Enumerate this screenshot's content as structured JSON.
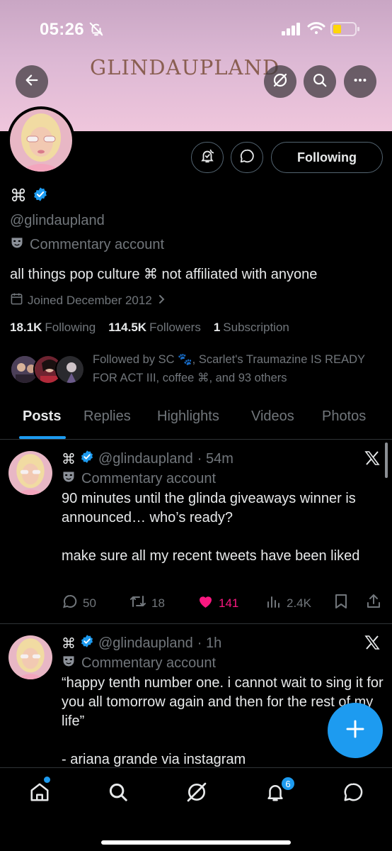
{
  "status_bar": {
    "time": "05:26"
  },
  "banner": {
    "title": "GLINDAUPLAND"
  },
  "profile": {
    "display_name": "⌘",
    "handle": "@glindaupland",
    "label": "Commentary account",
    "bio": "all things pop culture ⌘ not affiliated with anyone",
    "joined": "Joined December 2012",
    "following_button": "Following",
    "stats": {
      "following_count": "18.1K",
      "following_label": "Following",
      "followers_count": "114.5K",
      "followers_label": "Followers",
      "subscriptions_count": "1",
      "subscriptions_label": "Subscription"
    },
    "followed_by": "Followed by SC 🐾, Scarlet's Traumazine IS READY FOR ACT III, coffee ⌘, and 93 others"
  },
  "tabs": [
    "Posts",
    "Replies",
    "Highlights",
    "Videos",
    "Photos"
  ],
  "active_tab": "Posts",
  "posts": [
    {
      "display_name": "⌘",
      "handle": "@glindaupland",
      "time": "· 54m",
      "label": "Commentary account",
      "text": "90 minutes until the glinda giveaways winner is announced… who’s ready?\n\nmake sure all my recent tweets have been liked",
      "replies": "50",
      "reposts": "18",
      "likes": "141",
      "views": "2.4K"
    },
    {
      "display_name": "⌘",
      "handle": "@glindaupland",
      "time": "· 1h",
      "label": "Commentary account",
      "text": "“happy tenth number one. i cannot wait to sing it for you all tomorrow again and then for the rest of my life”\n\n- ariana grande via instagram"
    }
  ],
  "nav": {
    "notifications_badge": "6"
  },
  "colors": {
    "accent": "#1d9bf0",
    "like": "#f91880",
    "background": "#000000",
    "muted": "#71767b"
  },
  "icons": [
    "back-arrow-icon",
    "grok-icon",
    "search-icon",
    "more-icon",
    "notify-bell-icon",
    "message-icon",
    "verified-icon",
    "theater-mask-icon",
    "calendar-icon",
    "chevron-right-icon",
    "x-logo-icon",
    "reply-icon",
    "repost-icon",
    "heart-icon",
    "views-icon",
    "bookmark-icon",
    "share-icon",
    "compose-plus-icon",
    "home-icon",
    "notifications-icon",
    "messages-icon"
  ]
}
